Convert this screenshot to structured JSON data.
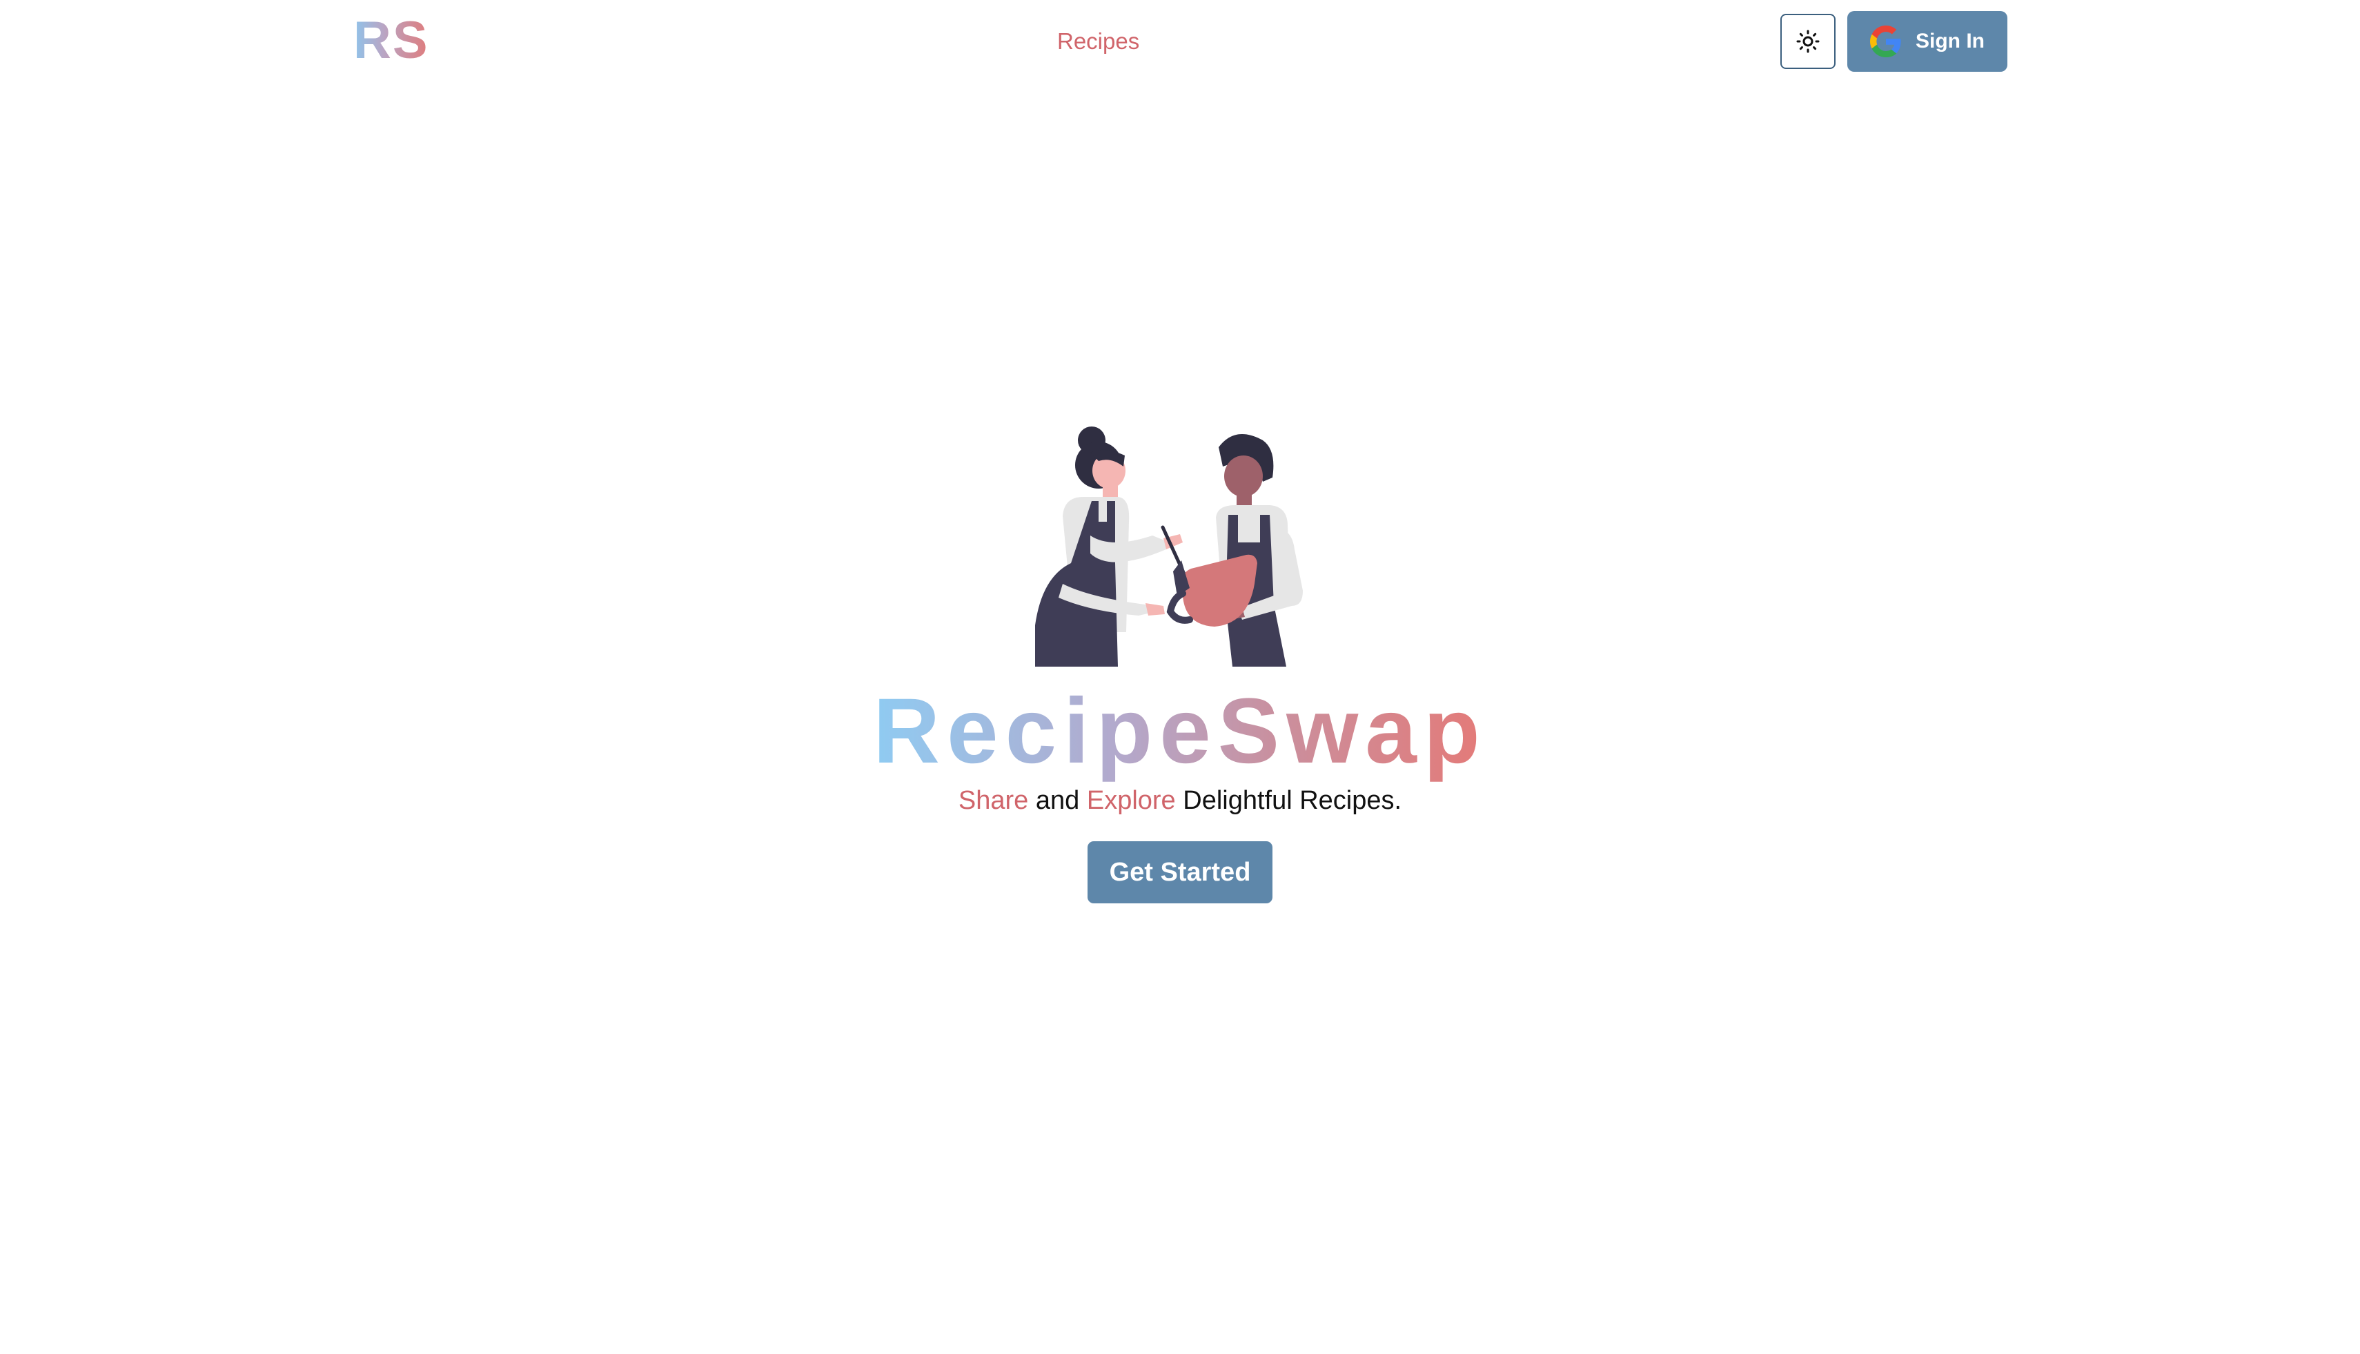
{
  "nav": {
    "logo": "RS",
    "links": [
      {
        "label": "Recipes"
      }
    ],
    "theme_toggle_icon": "sun-icon",
    "signin": {
      "label": "Sign In",
      "icon": "google-icon"
    }
  },
  "hero": {
    "title": "RecipeSwap",
    "tagline": {
      "part1": "Share",
      "part2": " and ",
      "part3": "Explore",
      "part4": " Delightful Recipes."
    },
    "cta_label": "Get Started",
    "illustration": "cooking-couple-illustration"
  },
  "colors": {
    "primary": "#5e87aa",
    "accent": "#d0646a",
    "gradient_start": "#8fcbf2",
    "gradient_end": "#e47a78"
  }
}
